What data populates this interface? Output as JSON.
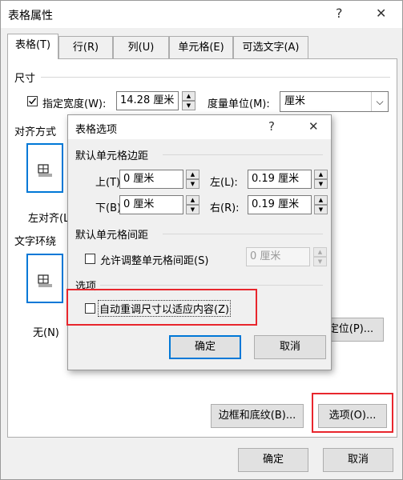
{
  "window": {
    "title": "表格属性",
    "help": "?",
    "close": "✕"
  },
  "tabs": [
    {
      "label": "表格(T)"
    },
    {
      "label": "行(R)"
    },
    {
      "label": "列(U)"
    },
    {
      "label": "单元格(E)"
    },
    {
      "label": "可选文字(A)"
    }
  ],
  "size": {
    "section": "尺寸",
    "specify_width_label": "指定宽度(W):",
    "specify_width_checked": true,
    "width_value": "14.28 厘米",
    "unit_label": "度量单位(M):",
    "unit_value": "厘米"
  },
  "alignment": {
    "section": "对齐方式",
    "left_label": "左对齐(L"
  },
  "wrapping": {
    "section": "文字环绕",
    "none_label": "无(N)",
    "position_button": "定位(P)..."
  },
  "footer_panel": {
    "borders_button": "边框和底纹(B)...",
    "options_button": "选项(O)..."
  },
  "footer": {
    "ok": "确定",
    "cancel": "取消"
  },
  "options_dialog": {
    "title": "表格选项",
    "help": "?",
    "close": "✕",
    "margins_section": "默认单元格边距",
    "top_label": "上(T):",
    "top_value": "0 厘米",
    "left_label": "左(L):",
    "left_value": "0.19 厘米",
    "bottom_label": "下(B):",
    "bottom_value": "0 厘米",
    "right_label": "右(R):",
    "right_value": "0.19 厘米",
    "spacing_section": "默认单元格间距",
    "allow_spacing_label": "允许调整单元格间距(S)",
    "allow_spacing_checked": false,
    "spacing_value": "0 厘米",
    "options_section": "选项",
    "autoresize_label": "自动重调尺寸以适应内容(Z)",
    "autoresize_checked": false,
    "ok": "确定",
    "cancel": "取消"
  },
  "highlight_color": "#e8262d",
  "accent_color": "#0078d7"
}
